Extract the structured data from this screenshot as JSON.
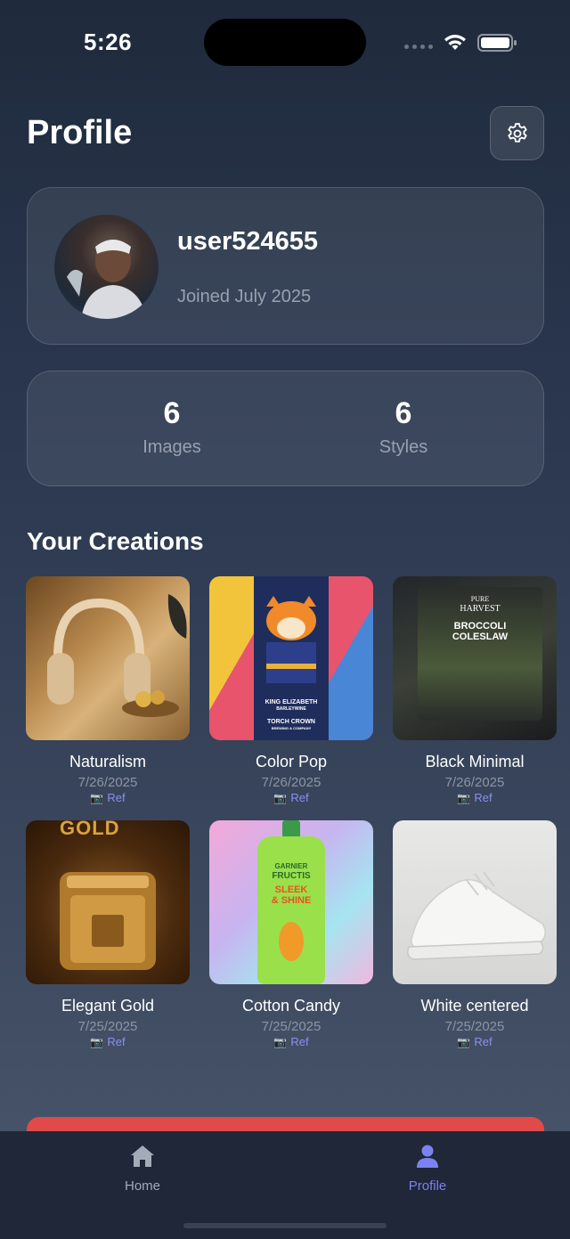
{
  "status_bar": {
    "time": "5:26"
  },
  "header": {
    "title": "Profile",
    "settings_icon": "gear-icon"
  },
  "profile": {
    "username": "user524655",
    "joined": "Joined July 2025"
  },
  "stats": [
    {
      "value": "6",
      "label": "Images"
    },
    {
      "value": "6",
      "label": "Styles"
    }
  ],
  "creations": {
    "title": "Your Creations",
    "items": [
      {
        "name": "Naturalism",
        "date": "7/26/2025",
        "ref": "Ref"
      },
      {
        "name": "Color Pop",
        "date": "7/26/2025",
        "ref": "Ref"
      },
      {
        "name": "Black Minimal",
        "date": "7/26/2025",
        "ref": "Ref"
      },
      {
        "name": "Elegant Gold",
        "date": "7/25/2025",
        "ref": "Ref"
      },
      {
        "name": "Cotton Candy",
        "date": "7/25/2025",
        "ref": "Ref"
      },
      {
        "name": "White centered",
        "date": "7/25/2025",
        "ref": "Ref"
      }
    ],
    "thumb_text": {
      "colorpop_line1": "KING ELIZABETH",
      "colorpop_line2": "BARLEYWINE",
      "colorpop_line3": "TORCH CROWN",
      "colorpop_line4": "BREWING & COMPANY",
      "black_line1": "PURE",
      "black_line2": "HARVEST",
      "black_line3": "BROCCOLI",
      "black_line4": "COLESLAW",
      "gold_text": "GOLD",
      "cotton_line1": "GARNIER",
      "cotton_line2": "FRUCTIS",
      "cotton_line3": "SLEEK",
      "cotton_line4": "& SHINE"
    }
  },
  "tab_bar": {
    "tabs": [
      {
        "label": "Home",
        "icon": "home-icon",
        "active": false
      },
      {
        "label": "Profile",
        "icon": "person-icon",
        "active": true
      }
    ]
  },
  "colors": {
    "accent": "#7b83f0",
    "inactive_tab": "#a3abb8",
    "danger": "#e04a4a"
  }
}
